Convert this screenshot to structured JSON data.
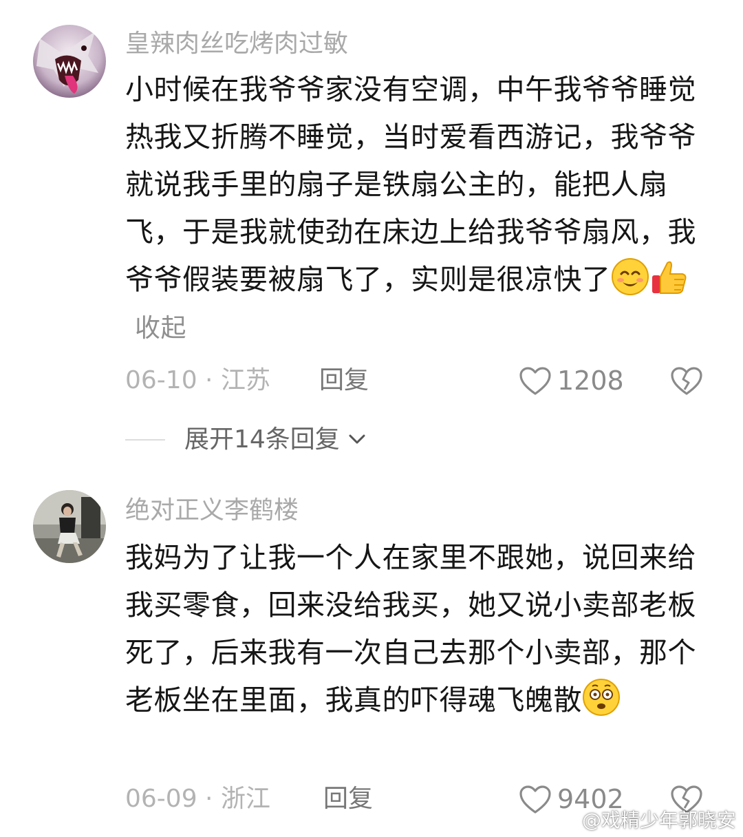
{
  "comments": [
    {
      "username": "皇辣肉丝吃烤肉过敏",
      "avatar_icon": "wolf-avatar-icon",
      "text": "小时候在我爷爷家没有空调，中午我爷爷睡觉热我又折腾不睡觉，当时爱看西游记，我爷爷就说我手里的扇子是铁扇公主的，能把人扇飞，于是我就使劲在床边上给我爷爷扇风，我爷爷假装要被扇飞了，实则是很凉快了",
      "emojis": [
        "smiling-face-emoji",
        "thumbs-up-emoji"
      ],
      "collapse_label": "收起",
      "date_location": "06-10 · 江苏",
      "reply_label": "回复",
      "like_count": "1208",
      "expand_label": "展开14条回复"
    },
    {
      "username": "绝对正义李鹤楼",
      "avatar_icon": "person-avatar-icon",
      "text": "我妈为了让我一个人在家里不跟她，说回来给我买零食，回来没给我买，她又说小卖部老板死了，后来我有一次自己去那个小卖部，那个老板坐在里面，我真的吓得魂飞魄散",
      "emojis": [
        "shocked-face-emoji"
      ],
      "date_location": "06-09 · 浙江",
      "reply_label": "回复",
      "like_count": "9402"
    }
  ],
  "watermark": {
    "icon": "weibo-logo-icon",
    "text": "@戏精少年郭晓安"
  },
  "colors": {
    "username": "#a9a9a9",
    "body": "#161616",
    "meta": "#b3b3b3",
    "icon_gray": "#8a8a8a"
  }
}
